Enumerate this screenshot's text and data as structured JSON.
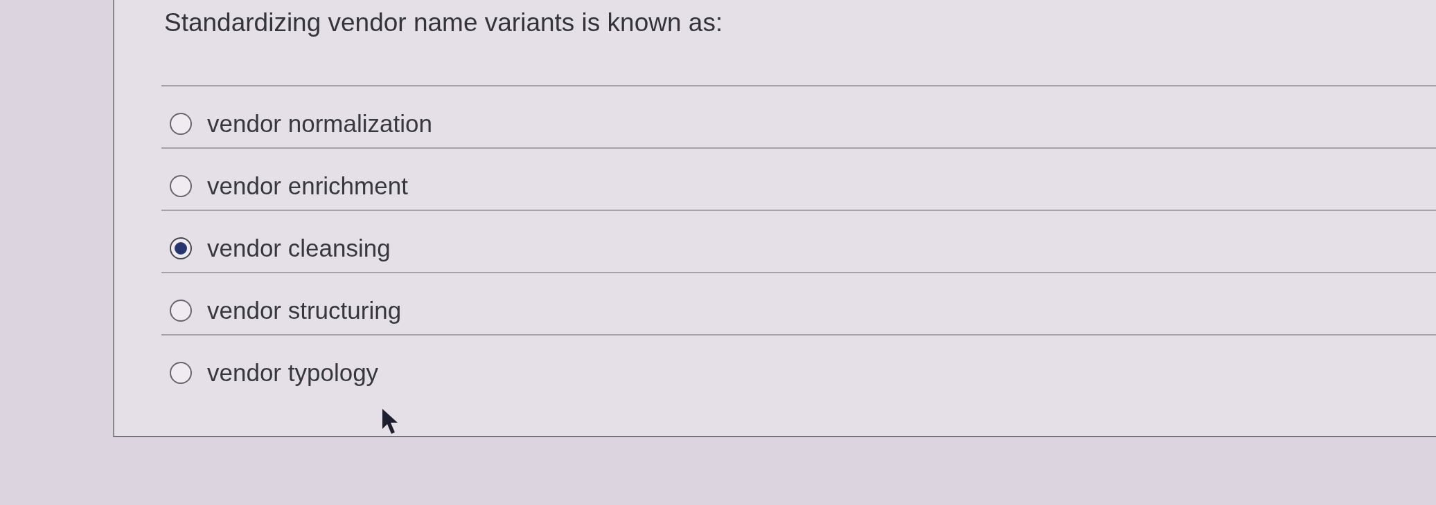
{
  "question": {
    "text": "Standardizing vendor name variants is known as:"
  },
  "options": [
    {
      "label": "vendor normalization",
      "selected": false
    },
    {
      "label": "vendor enrichment",
      "selected": false
    },
    {
      "label": "vendor cleansing",
      "selected": true
    },
    {
      "label": "vendor structuring",
      "selected": false
    },
    {
      "label": "vendor typology",
      "selected": false
    }
  ]
}
